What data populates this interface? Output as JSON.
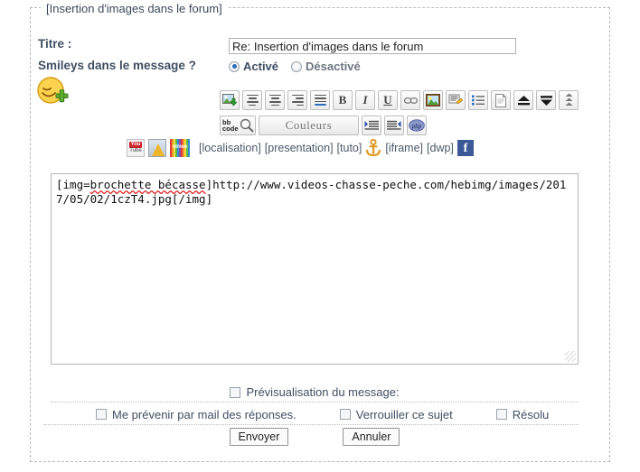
{
  "form": {
    "legend": "[Insertion d'images dans le forum]",
    "titre_label": "Titre :",
    "smileys_label": "Smileys dans le message ?",
    "title_value": "Re: Insertion d'images dans le forum",
    "title_placeholder": "",
    "radio_on": "Activé",
    "radio_off": "Désactivé",
    "smiley_icon": "add-smiley-icon"
  },
  "toolbar": {
    "row1": [
      {
        "name": "insert-image-icon",
        "label": ""
      },
      {
        "name": "align-left-icon",
        "label": ""
      },
      {
        "name": "align-center-icon",
        "label": ""
      },
      {
        "name": "align-right-icon",
        "label": ""
      },
      {
        "name": "align-justify-icon",
        "label": ""
      },
      {
        "name": "bold-button",
        "label": "B"
      },
      {
        "name": "italic-button",
        "label": "I"
      },
      {
        "name": "underline-button",
        "label": "U"
      },
      {
        "name": "link-icon",
        "label": ""
      },
      {
        "name": "image-icon",
        "label": ""
      },
      {
        "name": "quote-icon",
        "label": ""
      },
      {
        "name": "list-icon",
        "label": ""
      },
      {
        "name": "page-icon",
        "label": ""
      },
      {
        "name": "move-up-icon",
        "label": ""
      },
      {
        "name": "move-down-icon",
        "label": ""
      },
      {
        "name": "collapse-icon",
        "label": ""
      }
    ],
    "row2": {
      "bbcode_line1": "bb",
      "bbcode_line2": "code",
      "couleurs_label": "Couleurs",
      "indent_icon": "indent-icon",
      "outdent_icon": "outdent-icon",
      "php_label": "php"
    },
    "row3": {
      "youtube_top": "You",
      "youtube_bottom": "Tube",
      "vimeo_label": "vimeo",
      "tag_localisation": "[localisation]",
      "tag_presentation": "[presentation]",
      "tag_tuto": "[tuto]",
      "tag_iframe": "[iframe]",
      "tag_dwp": "[dwp]",
      "facebook_label": "f"
    }
  },
  "message": {
    "part1": "[img=",
    "misspelled": "brochette bécasse",
    "part2": "]http://www.videos-chasse-peche.com/hebimg/images/2017/05/02/1czT4.jpg[/img]"
  },
  "options": {
    "preview_label": "Prévisualisation du message:",
    "notify_label": "Me prévenir par mail des réponses.",
    "lock_label": "Verrouiller ce sujet",
    "solved_label": "Résolu"
  },
  "buttons": {
    "submit": "Envoyer",
    "cancel": "Annuler"
  },
  "colors": {
    "label": "#3f4f63",
    "radio_selected": "#2a6ebb",
    "misspell_underline": "#e01b1b",
    "facebook": "#3b5998",
    "youtube": "#cc2229"
  }
}
